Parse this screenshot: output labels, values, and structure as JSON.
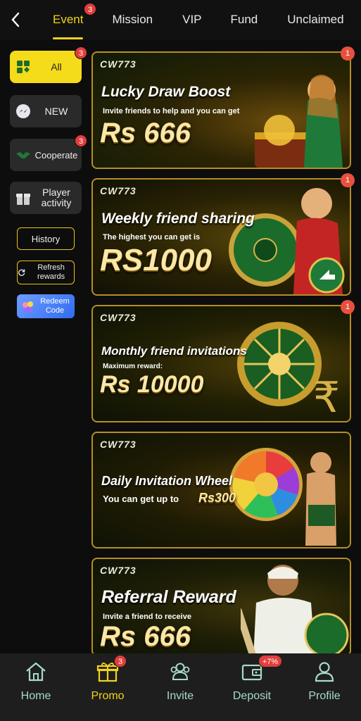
{
  "tabs": [
    {
      "label": "Event",
      "badge": "3"
    },
    {
      "label": "Mission"
    },
    {
      "label": "VIP"
    },
    {
      "label": "Fund"
    },
    {
      "label": "Unclaimed"
    }
  ],
  "sidebar": {
    "categories": [
      {
        "label": "All",
        "badge": "3"
      },
      {
        "label": "NEW"
      },
      {
        "label": "Cooperate",
        "badge": "3"
      },
      {
        "label": "Player activity"
      }
    ],
    "history": "History",
    "refresh": "Refresh rewards",
    "redeem": "Redeem Code"
  },
  "banners": [
    {
      "logo": "CW773",
      "title": "Lucky Draw Boost",
      "subtitle": "Invite friends to help and you can get",
      "amount": "Rs 666",
      "badge": "1"
    },
    {
      "logo": "CW773",
      "title": "Weekly friend sharing",
      "subtitle": "The highest you can get is",
      "amount": "RS1000",
      "badge": "1"
    },
    {
      "logo": "CW773",
      "title": "Monthly friend invitations",
      "subtitle": "Maximum reward:",
      "amount": "Rs 10000",
      "badge": "1"
    },
    {
      "logo": "CW773",
      "title": "Daily Invitation Wheel",
      "subtitle": "You can get up to",
      "amount": "Rs300"
    },
    {
      "logo": "CW773",
      "title": "Referral Reward",
      "subtitle": "Invite a friend to receive",
      "amount": "Rs 666"
    }
  ],
  "bottom_nav": [
    {
      "label": "Home",
      "icon": "home-icon"
    },
    {
      "label": "Promo",
      "icon": "gift-icon",
      "badge": "3"
    },
    {
      "label": "Invite",
      "icon": "users-icon"
    },
    {
      "label": "Deposit",
      "icon": "wallet-icon",
      "badge": "+7%"
    },
    {
      "label": "Profile",
      "icon": "person-icon"
    }
  ],
  "colors": {
    "accent": "#f3d21a",
    "badge": "#e23d3d",
    "nav_label": "#a6dcc6",
    "banner_border": "#b68e22"
  }
}
